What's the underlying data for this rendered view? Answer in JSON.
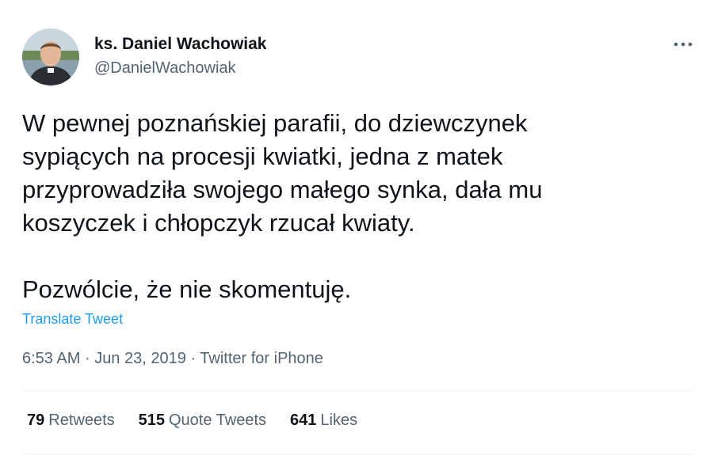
{
  "author": {
    "name": "ks. Daniel Wachowiak",
    "handle": "@DanielWachowiak"
  },
  "tweet": {
    "paragraphs": [
      "W pewnej poznańskiej parafii, do dziewczynek\nsypiących na procesji kwiatki, jedna z matek\nprzyprowadziła swojego małego synka, dała mu\nkoszyczek i chłopczyk rzucał kwiaty.",
      "Pozwólcie, że nie skomentuję."
    ],
    "translate_label": "Translate Tweet",
    "time": "6:53 AM",
    "date": "Jun 23, 2019",
    "source": "Twitter for iPhone",
    "separator": "·"
  },
  "stats": {
    "retweets_count": "79",
    "retweets_label": "Retweets",
    "quote_count": "515",
    "quote_label": "Quote Tweets",
    "likes_count": "641",
    "likes_label": "Likes"
  },
  "icons": {
    "more": "more-options-icon"
  },
  "colors": {
    "text": "#0f1419",
    "secondary": "#536471",
    "link": "#1d9bf0",
    "divider": "#eff3f4"
  }
}
